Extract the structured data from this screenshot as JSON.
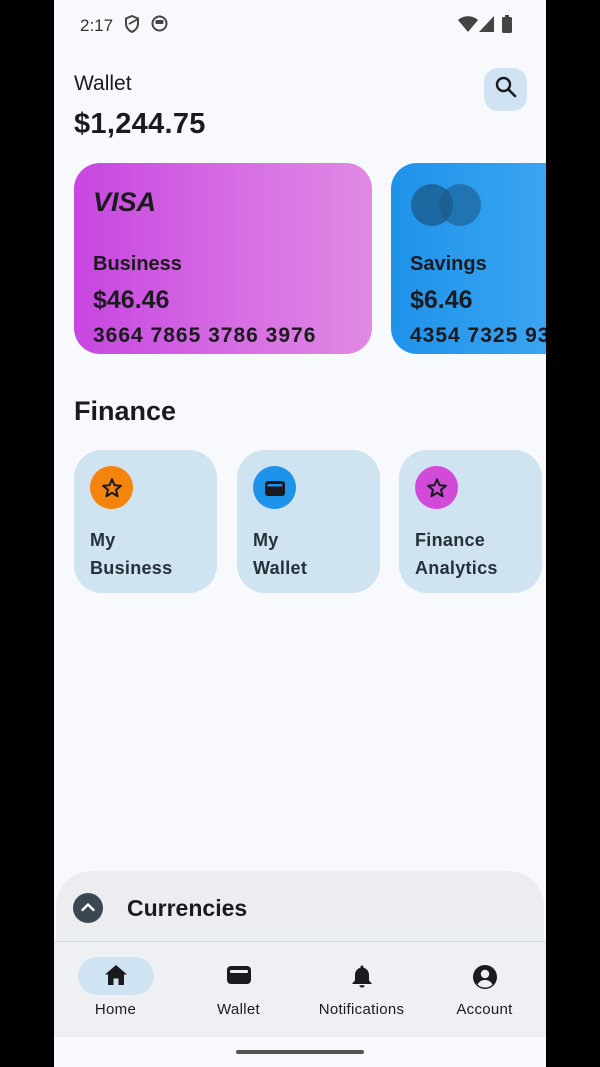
{
  "status_bar": {
    "time": "2:17"
  },
  "header": {
    "title": "Wallet",
    "balance": "$1,244.75"
  },
  "cards": [
    {
      "brand": "VISA",
      "name": "Business",
      "amount": "$46.46",
      "number": "3664 7865 3786 3976",
      "color": "#c746e0"
    },
    {
      "brand": "mastercard",
      "name": "Savings",
      "amount": "$6.46",
      "number": "4354 7325 93",
      "color": "#1e93ea"
    }
  ],
  "finance": {
    "title": "Finance",
    "tiles": [
      {
        "label": "My\nBusiness",
        "icon": "star-icon",
        "icon_color": "#f5840c"
      },
      {
        "label": "My\nWallet",
        "icon": "wallet-icon",
        "icon_color": "#1e93ea"
      },
      {
        "label": "Finance\nAnalytics",
        "icon": "star-icon",
        "icon_color": "#d14bd9"
      }
    ]
  },
  "currencies": {
    "title": "Currencies"
  },
  "nav": {
    "items": [
      {
        "label": "Home",
        "icon": "home-icon",
        "active": true
      },
      {
        "label": "Wallet",
        "icon": "wallet-icon",
        "active": false
      },
      {
        "label": "Notifications",
        "icon": "bell-icon",
        "active": false
      },
      {
        "label": "Account",
        "icon": "account-icon",
        "active": false
      }
    ]
  }
}
